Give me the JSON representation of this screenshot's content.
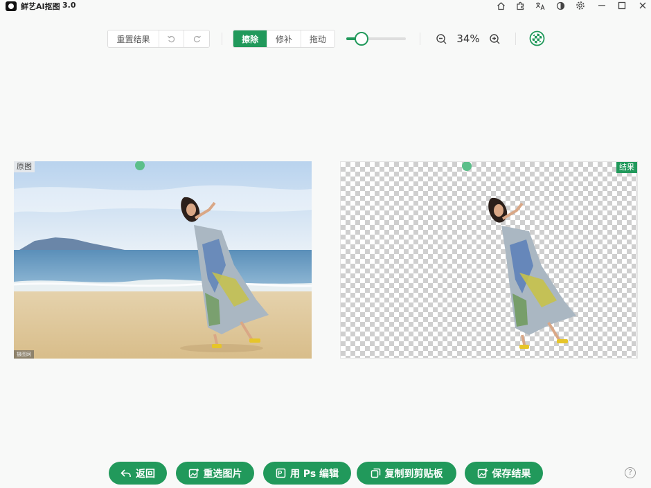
{
  "app": {
    "title": "鲜艺AI抠图",
    "version": "3.0"
  },
  "window_controls": [
    "home-icon",
    "plugin-icon",
    "translate-icon",
    "theme-icon",
    "settings-icon",
    "minimize-icon",
    "maximize-icon",
    "close-icon"
  ],
  "toolbar": {
    "reset_label": "重置结果",
    "undo_icon": "undo-icon",
    "redo_icon": "redo-icon",
    "modes": [
      {
        "label": "擦除",
        "active": true
      },
      {
        "label": "修补",
        "active": false
      },
      {
        "label": "拖动",
        "active": false
      }
    ],
    "brush_size_level": 0.18,
    "zoom_text": "34%",
    "zoom_out_icon": "zoom-out-icon",
    "zoom_in_icon": "zoom-in-icon",
    "bg_toggle_icon": "background-toggle-icon"
  },
  "panels": {
    "original_label": "原图",
    "result_label": "结果",
    "watermark_text": "摄图网"
  },
  "actions": [
    {
      "label": "返回",
      "icon": "return-icon"
    },
    {
      "label": "重选图片",
      "icon": "reselect-image-icon"
    },
    {
      "label": "用 Ps 编辑",
      "icon": "ps-edit-icon"
    },
    {
      "label": "复制到剪贴板",
      "icon": "copy-clipboard-icon"
    },
    {
      "label": "保存结果",
      "icon": "save-image-icon"
    }
  ],
  "colors": {
    "accent": "#21995b",
    "background": "#f8f9f8"
  }
}
